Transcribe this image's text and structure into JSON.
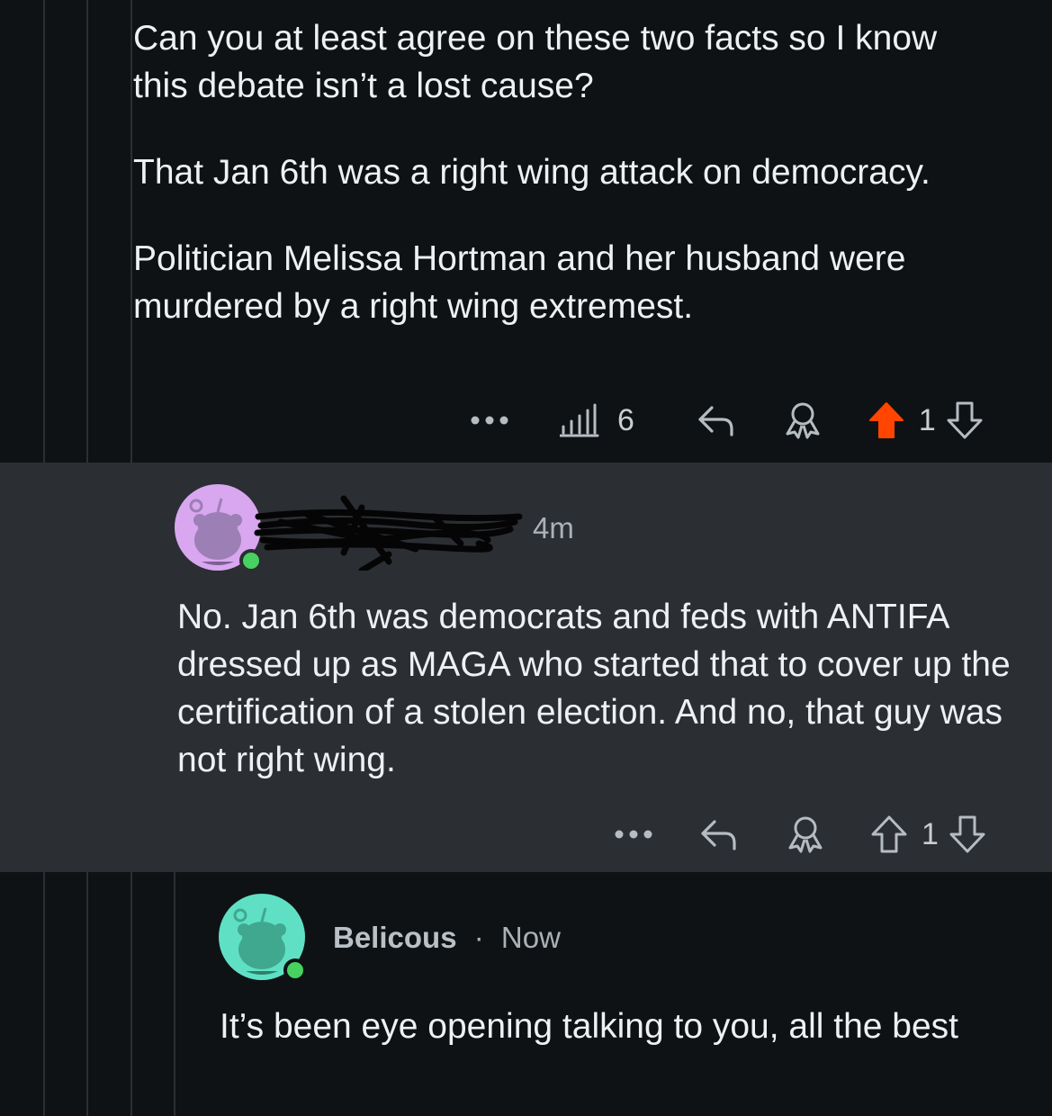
{
  "comments": [
    {
      "paragraphs": [
        "Can you at least agree on these two facts so I know this debate isn’t a lost cause?",
        "That Jan 6th was a right wing attack on democracy.",
        "Politician Melissa Hortman and her husband were murdered by a right wing extremest."
      ],
      "views": "6",
      "votes": "1",
      "upvoted": true
    },
    {
      "author": "",
      "time": "4m",
      "body": "No. Jan 6th was democrats and feds with ANTIFA dressed up as MAGA who started that to cover up the certification of a stolen election. And no, that guy was not right wing.",
      "votes": "1",
      "upvoted": false
    },
    {
      "author": "Belicous",
      "separator": "·",
      "time": "Now",
      "body": "It’s been eye opening talking to you, all the best"
    }
  ],
  "colors": {
    "upvote_active": "#ff4500",
    "online": "#46d160",
    "avatar_purple": "#d9a6f0",
    "avatar_teal": "#5fe0c4"
  },
  "icons": [
    "more-icon",
    "views-icon",
    "reply-icon",
    "award-icon",
    "upvote-icon",
    "downvote-icon"
  ]
}
